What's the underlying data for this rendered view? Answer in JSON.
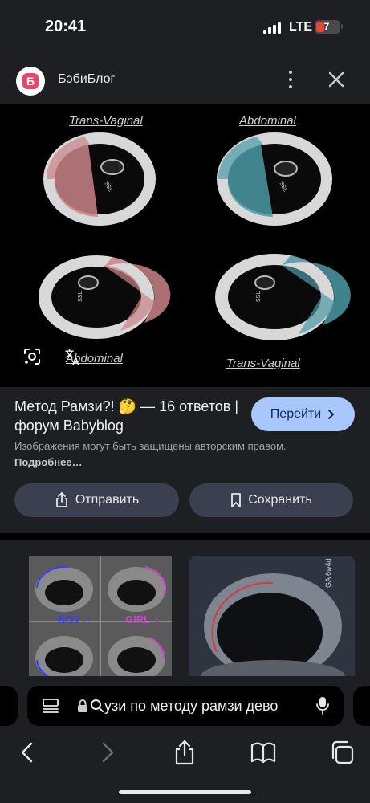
{
  "status_bar": {
    "time": "20:41",
    "network": "LTE",
    "battery_level": "7"
  },
  "header": {
    "site_name": "БэбиБлог",
    "logo_letter": "Б"
  },
  "image": {
    "labels": {
      "top_left": "Trans-Vaginal",
      "top_right": "Abdominal",
      "bottom_left": "Abdominal",
      "bottom_right": "Trans-Vaginal"
    },
    "scan_marks": [
      "SSL",
      "SSL",
      "SSL",
      "SSL"
    ]
  },
  "result": {
    "title": "Метод Рамзи?! 🤔 — 16 ответов | форум Babyblog",
    "go_label": "Перейти",
    "copyright_text": "Изображения могут быть защищены авторским правом.",
    "more_link": "Подробнее…",
    "share_label": "Отправить",
    "save_label": "Сохранить"
  },
  "related": {
    "thumb1_text_boy": "BOY ♂",
    "thumb1_text_girl": "GIRL ♀",
    "thumb2_text": "GA 6w4d 10.03.2023"
  },
  "browser": {
    "url_text": "узи по методу рамзи дево"
  },
  "colors": {
    "accent_button": "#a9c7fa",
    "panel_bg": "#1e1f22",
    "secondary_button": "#3b4050",
    "trans_vaginal_fill": "#c98388",
    "abdominal_fill": "#4b9aa6"
  }
}
